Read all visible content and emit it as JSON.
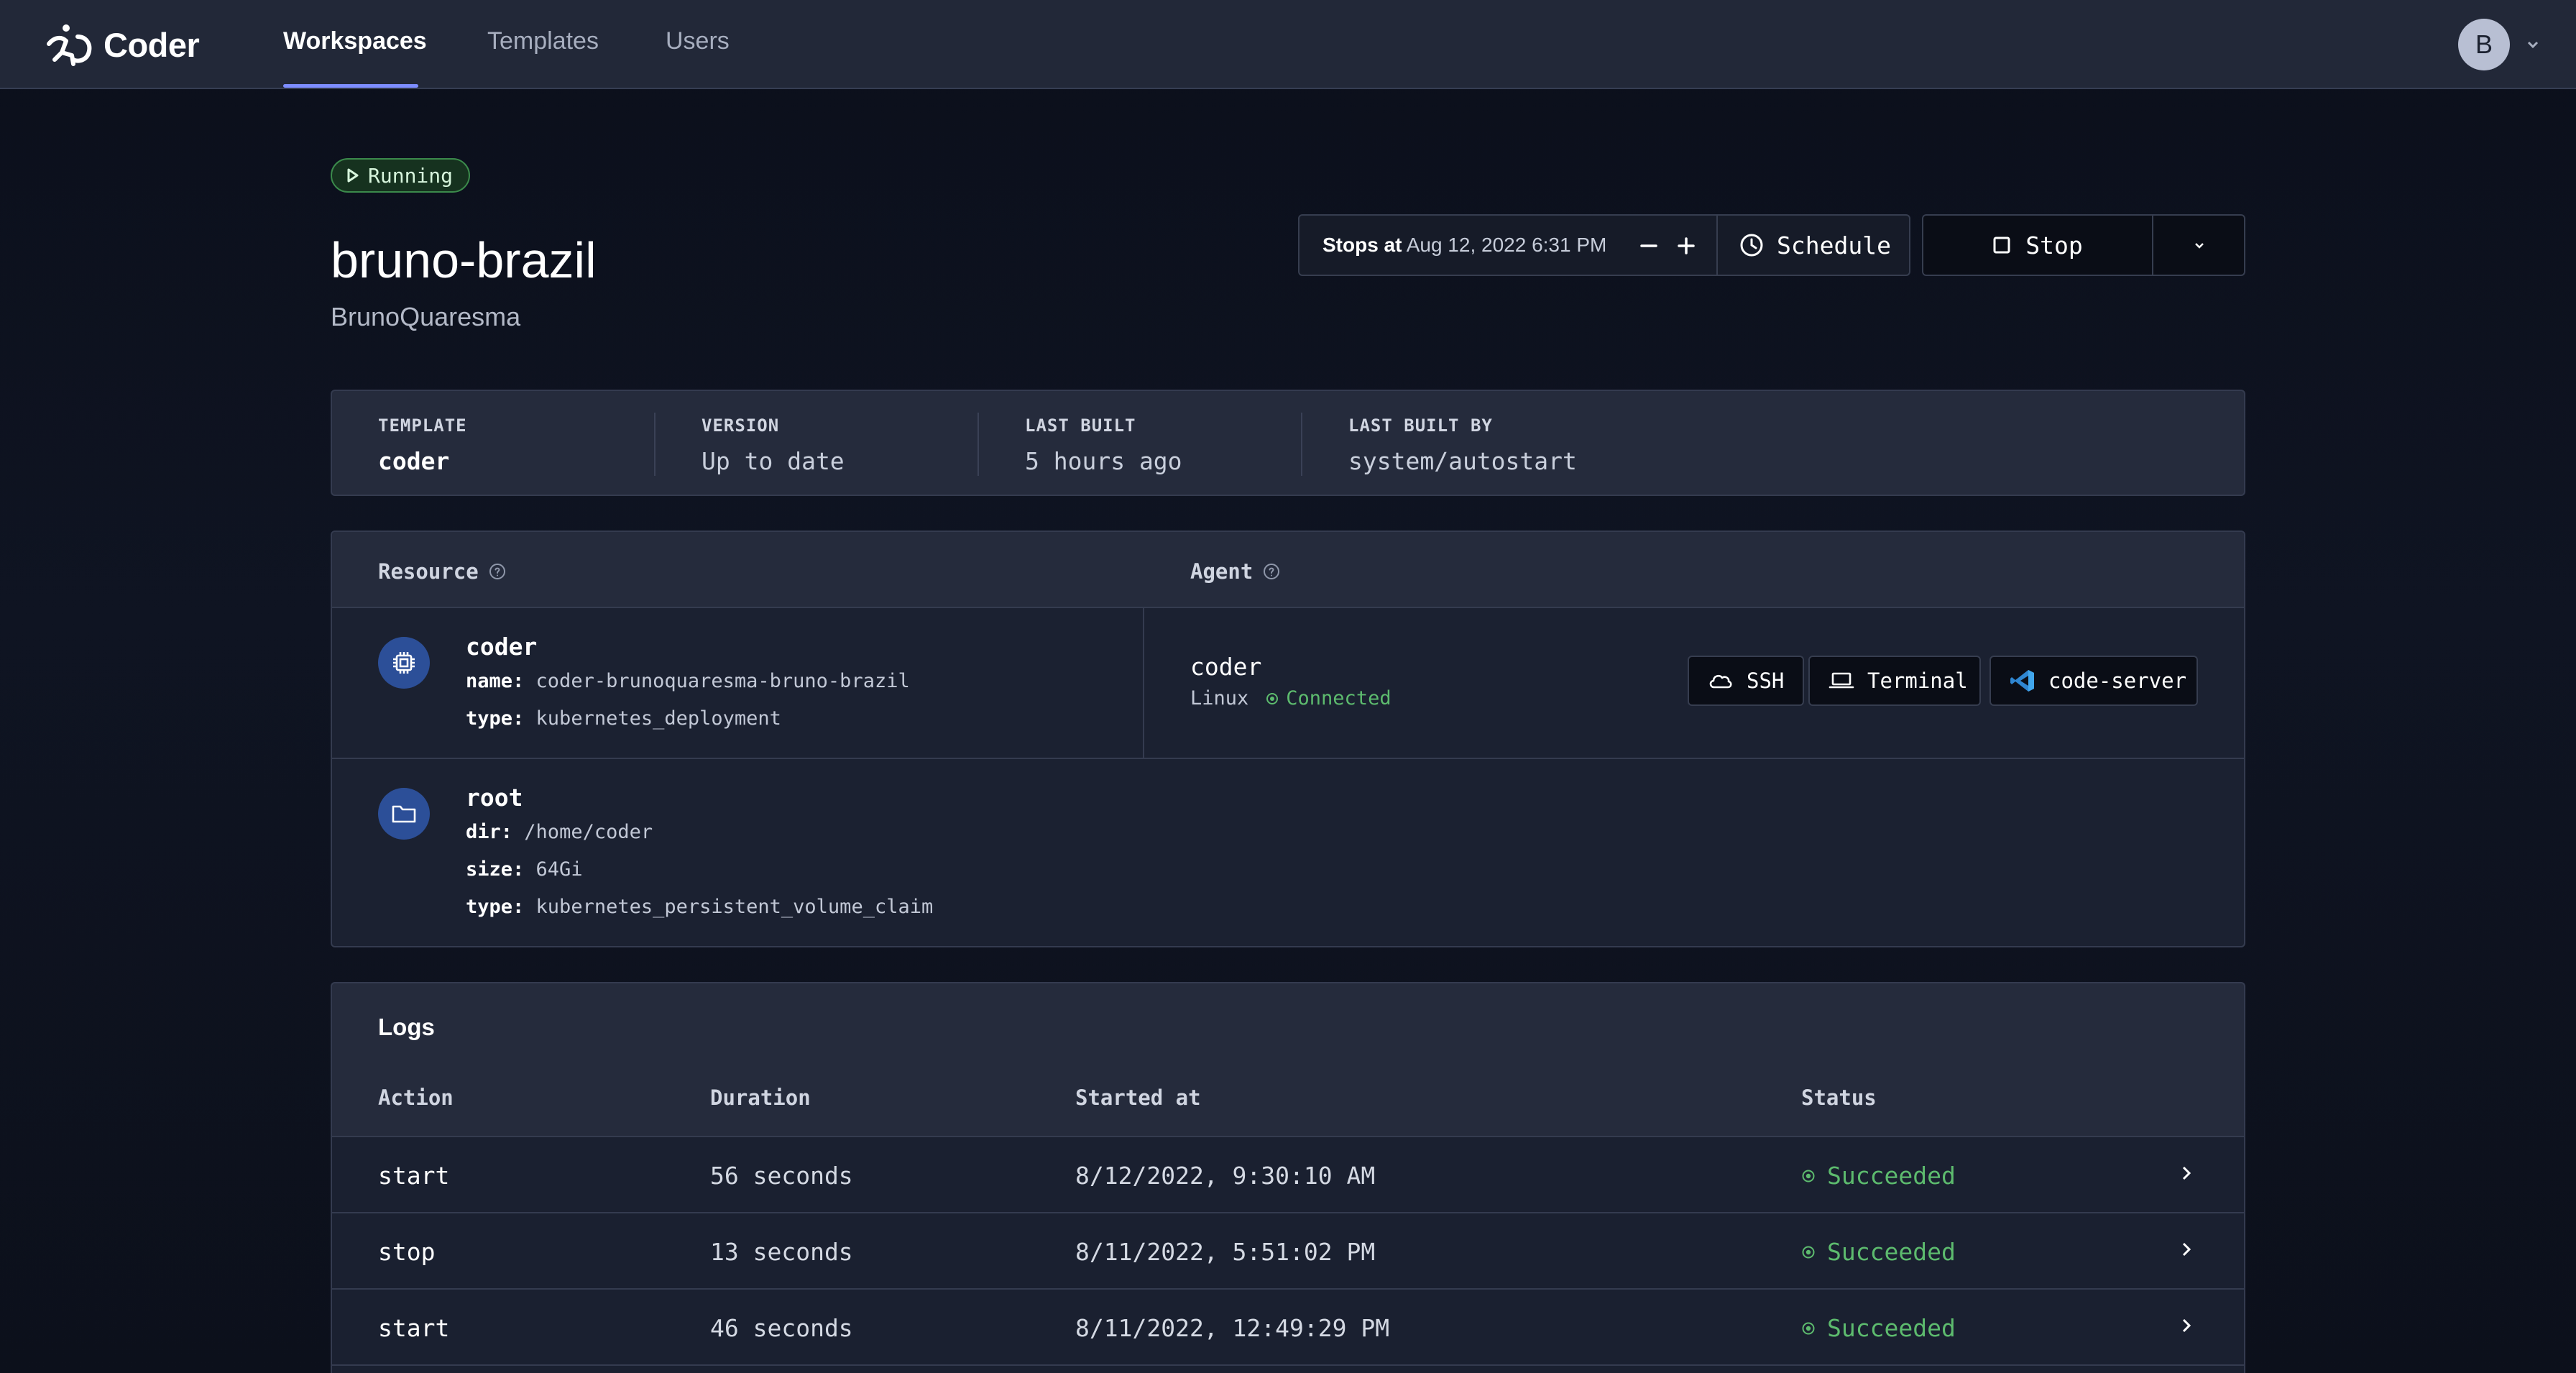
{
  "nav": {
    "brand": "Coder",
    "links": [
      {
        "label": "Workspaces",
        "active": true
      },
      {
        "label": "Templates",
        "active": false
      },
      {
        "label": "Users",
        "active": false
      }
    ],
    "avatar_initial": "B"
  },
  "workspace": {
    "status": "Running",
    "name": "bruno-brazil",
    "owner": "BrunoQuaresma"
  },
  "schedule": {
    "stops_label": "Stops at",
    "stops_time": "Aug 12, 2022 6:31 PM",
    "schedule_label": "Schedule",
    "stop_label": "Stop"
  },
  "stats": [
    {
      "label": "TEMPLATE",
      "value": "coder"
    },
    {
      "label": "VERSION",
      "value": "Up to date"
    },
    {
      "label": "LAST BUILT",
      "value": "5 hours ago"
    },
    {
      "label": "LAST BUILT BY",
      "value": "system/autostart"
    }
  ],
  "resources": {
    "resource_header": "Resource",
    "agent_header": "Agent",
    "items": [
      {
        "name": "coder",
        "fields": [
          {
            "key": "name:",
            "value": "coder-brunoquaresma-bruno-brazil"
          },
          {
            "key": "type:",
            "value": "kubernetes_deployment"
          }
        ],
        "agent": {
          "name": "coder",
          "os": "Linux",
          "status": "Connected",
          "buttons": [
            "SSH",
            "Terminal",
            "code-server"
          ]
        }
      },
      {
        "name": "root",
        "fields": [
          {
            "key": "dir:",
            "value": "/home/coder"
          },
          {
            "key": "size:",
            "value": "64Gi"
          },
          {
            "key": "type:",
            "value": "kubernetes_persistent_volume_claim"
          }
        ]
      }
    ]
  },
  "logs": {
    "title": "Logs",
    "columns": [
      "Action",
      "Duration",
      "Started at",
      "Status"
    ],
    "rows": [
      {
        "action": "start",
        "duration": "56 seconds",
        "started": "8/12/2022, 9:30:10 AM",
        "status": "Succeeded"
      },
      {
        "action": "stop",
        "duration": "13 seconds",
        "started": "8/11/2022, 5:51:02 PM",
        "status": "Succeeded"
      },
      {
        "action": "start",
        "duration": "46 seconds",
        "started": "8/11/2022, 12:49:29 PM",
        "status": "Succeeded"
      }
    ]
  },
  "colors": {
    "accent": "#7d8dff",
    "success": "#5dbb6e",
    "resource_icon_bg": "#2c4f98"
  },
  "icons": {
    "brand": "coder-logo-icon",
    "status": "play-icon",
    "schedule": "clock-icon",
    "stop": "square-icon",
    "ssh": "cloud-icon",
    "terminal": "laptop-icon",
    "code_server": "vscode-icon"
  }
}
